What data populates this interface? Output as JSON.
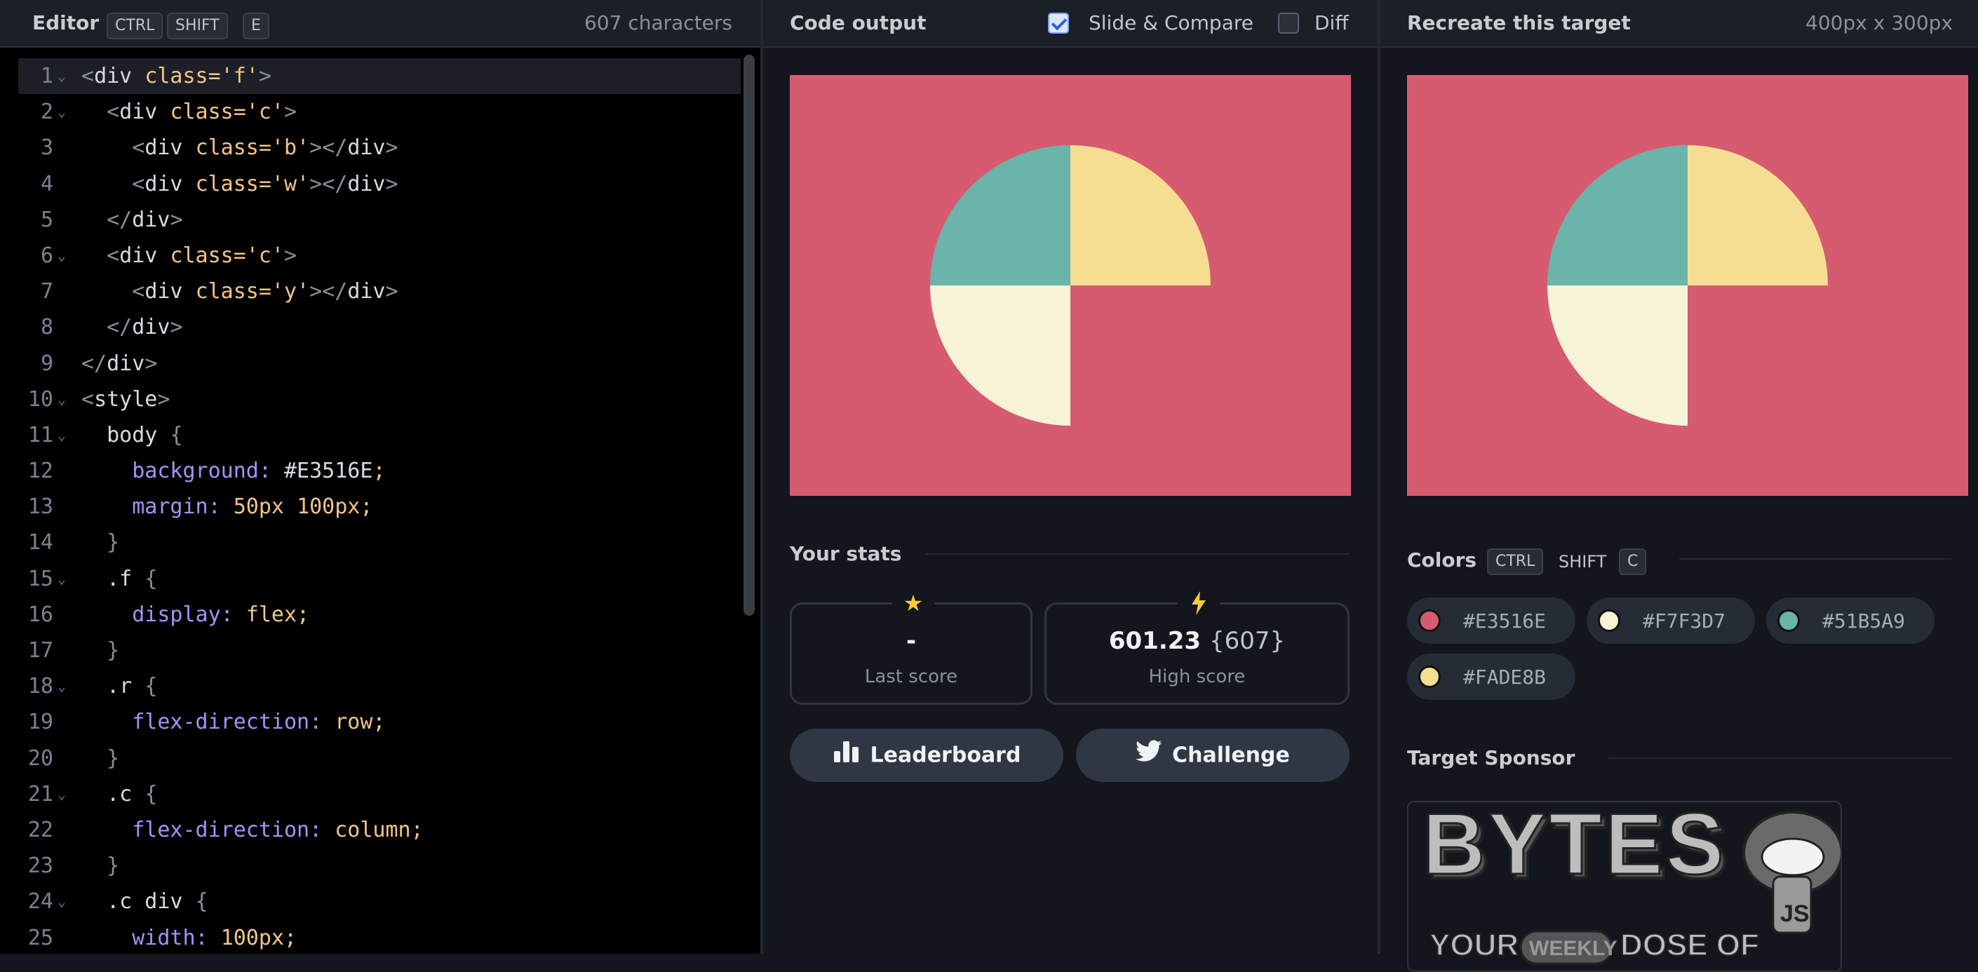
{
  "editor": {
    "title": "Editor",
    "shortcut": [
      "CTRL",
      "SHIFT",
      "E"
    ],
    "char_count": "607 characters",
    "lines": [
      "<div class='f'>",
      "  <div class='c'>",
      "    <div class='b'></div>",
      "    <div class='w'></div>",
      "  </div>",
      "  <div class='c'>",
      "    <div class='y'></div>",
      "  </div>",
      "</div>",
      "<style>",
      "  body {",
      "    background: #E3516E;",
      "    margin: 50px 100px;",
      "  }",
      "  .f {",
      "    display: flex;",
      "  }",
      "  .r {",
      "    flex-direction: row;",
      "  }",
      "  .c {",
      "    flex-direction: column;",
      "  }",
      "  .c div {",
      "    width: 100px;"
    ]
  },
  "output": {
    "title": "Code output",
    "slide_compare_label": "Slide & Compare",
    "slide_compare_checked": true,
    "diff_label": "Diff",
    "diff_checked": false,
    "stats_title": "Your stats",
    "last_score_value": "-",
    "last_score_label": "Last score",
    "high_score_value": "601.23",
    "high_score_chars": "{607}",
    "high_score_label": "High score",
    "leaderboard_label": "Leaderboard",
    "challenge_label": "Challenge",
    "star_icon": "star-icon",
    "bolt_icon": "bolt-icon"
  },
  "target": {
    "title": "Recreate this target",
    "dimensions": "400px x 300px",
    "colors_title": "Colors",
    "colors_shortcut": [
      "CTRL",
      "SHIFT",
      "C"
    ],
    "colors": [
      {
        "hex": "#E3516E",
        "swatch": "#D65B70"
      },
      {
        "hex": "#F7F3D7",
        "swatch": "#F7F3D7"
      },
      {
        "hex": "#51B5A9",
        "swatch": "#6AB4A9"
      },
      {
        "hex": "#FADE8B",
        "swatch": "#F5DE92"
      }
    ],
    "sponsor_title": "Target Sponsor",
    "sponsor_logo_text": "BYTES",
    "sponsor_tagline": [
      "YOUR",
      "WEEKLY",
      "DOSE OF",
      "JS"
    ]
  },
  "palette": {
    "pink": "#D65B70",
    "cream": "#F7F3D7",
    "teal": "#6AB4A9",
    "yellow": "#F5DE92"
  }
}
